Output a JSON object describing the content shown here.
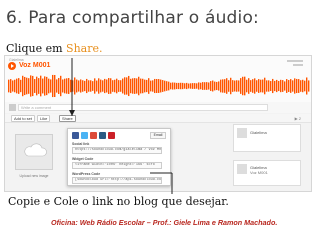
{
  "slide": {
    "title": "6. Para compartilhar o áudio:",
    "callout_top_prefix": "Clique em ",
    "callout_top_highlight": "Share.",
    "callout_bottom": "Copie e Cole o link no blog que desejar.",
    "footer": "Oficina: Web Rádio Escolar – Prof.: Giele Lima e Ramon Machado."
  },
  "player": {
    "uploader": "Gialelima",
    "track_title": "Voz M001",
    "comment_placeholder": "Write a comment",
    "waveform_color": "#ff5500"
  },
  "actions": {
    "add_label": "Add to set",
    "like_label": "Like",
    "share_label": "Share",
    "stats": "▶ 2"
  },
  "artwork": {
    "caption": "Upload new image"
  },
  "share_panel": {
    "email_label": "Email",
    "social_label": "Social link",
    "social_url": "https://soundcloud.com/gialelima / Voz M001",
    "widget_label": "Widget Code",
    "widget_code": "<iframe width='100%' height='166' scro",
    "wp_label": "WordPress Code",
    "wp_code": "[soundcloud url='http://api.soundcloud.com"
  },
  "sidebar": {
    "user_name": "Gialelima",
    "user2_name": "Gialelima",
    "user2_sub": "Voz M001"
  },
  "colors": {
    "accent_orange": "#ff5500",
    "highlight": "#e8901e",
    "footer_red": "#b8271f"
  }
}
